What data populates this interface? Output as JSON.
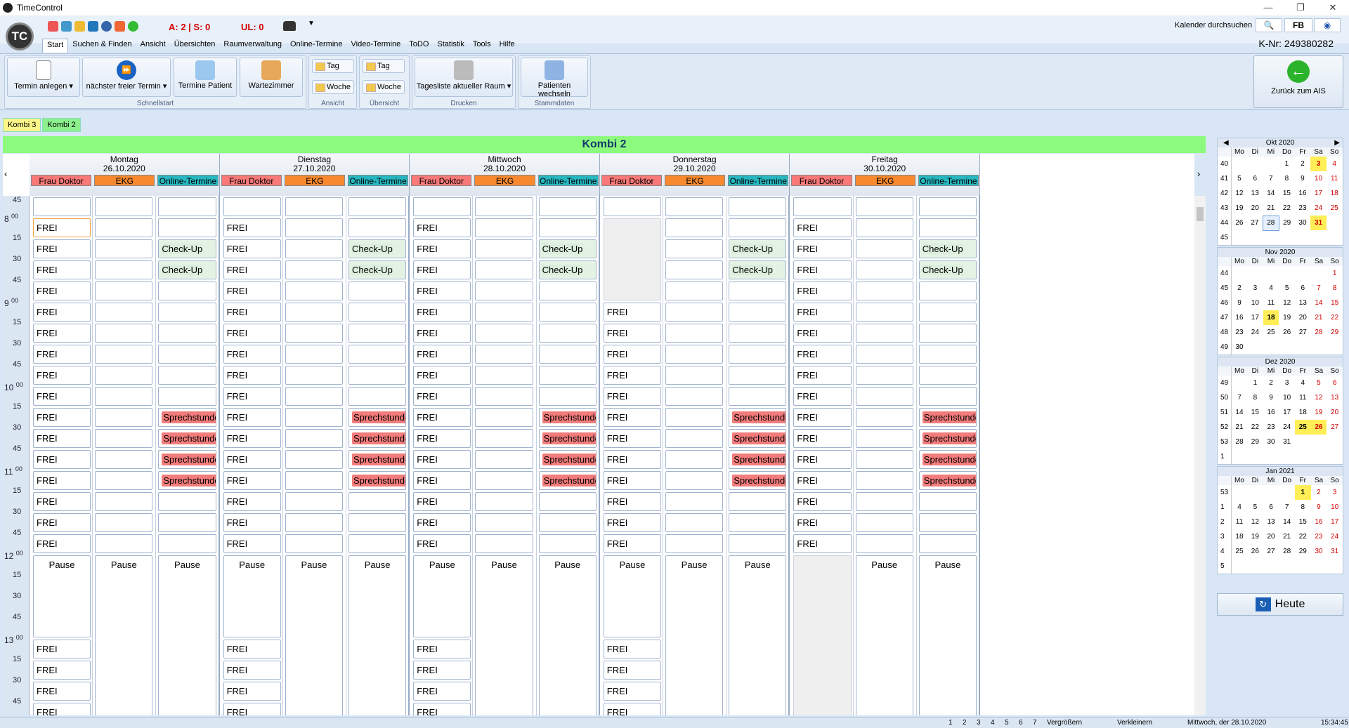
{
  "window": {
    "title": "TimeControl"
  },
  "toolbar": {
    "stat1": "A: 2 | S: 0",
    "stat2": "UL: 0",
    "search_label": "Kalender durchsuchen",
    "fb_label": "FB"
  },
  "menu": [
    "Start",
    "Suchen & Finden",
    "Ansicht",
    "Übersichten",
    "Raumverwaltung",
    "Online-Termine",
    "Video-Termine",
    "ToDO",
    "Statistik",
    "Tools",
    "Hilfe"
  ],
  "knr": "K-Nr: 249380282",
  "ribbon": {
    "termin_anlegen": "Termin anlegen",
    "naechster": "nächster freier Termin",
    "patient": "Termine Patient",
    "wartezimmer": "Wartezimmer",
    "schnellstart": "Schnellstart",
    "tag1": "Tag",
    "woche1": "Woche",
    "ansicht": "Ansicht",
    "tag2": "Tag",
    "woche2": "Woche",
    "uebersicht": "Übersicht",
    "tagesliste": "Tagesliste aktueller Raum",
    "drucken": "Drucken",
    "patienten_wechseln": "Patienten wechseln",
    "stammdaten": "Stammdaten",
    "zurueck": "Zurück zum AIS"
  },
  "tabs": [
    "Kombi 3",
    "Kombi 2"
  ],
  "banner": "Kombi 2",
  "resources": [
    "Frau Doktor",
    "EKG",
    "Online-Termine"
  ],
  "days": [
    {
      "name": "Montag",
      "date": "26.10.2020"
    },
    {
      "name": "Dienstag",
      "date": "27.10.2020"
    },
    {
      "name": "Mittwoch",
      "date": "28.10.2020"
    },
    {
      "name": "Donnerstag",
      "date": "29.10.2020"
    },
    {
      "name": "Freitag",
      "date": "30.10.2020"
    }
  ],
  "times": [
    {
      "h": "",
      "m": "45"
    },
    {
      "h": "8",
      "m": "00"
    },
    {
      "h": "",
      "m": "15"
    },
    {
      "h": "",
      "m": "30"
    },
    {
      "h": "",
      "m": "45"
    },
    {
      "h": "9",
      "m": "00"
    },
    {
      "h": "",
      "m": "15"
    },
    {
      "h": "",
      "m": "30"
    },
    {
      "h": "",
      "m": "45"
    },
    {
      "h": "10",
      "m": "00"
    },
    {
      "h": "",
      "m": "15"
    },
    {
      "h": "",
      "m": "30"
    },
    {
      "h": "",
      "m": "45"
    },
    {
      "h": "11",
      "m": "00"
    },
    {
      "h": "",
      "m": "15"
    },
    {
      "h": "",
      "m": "30"
    },
    {
      "h": "",
      "m": "45"
    },
    {
      "h": "12",
      "m": "00"
    },
    {
      "h": "",
      "m": "15"
    },
    {
      "h": "",
      "m": "30"
    },
    {
      "h": "",
      "m": "45"
    },
    {
      "h": "13",
      "m": "00"
    },
    {
      "h": "",
      "m": "15"
    },
    {
      "h": "",
      "m": "30"
    },
    {
      "h": "",
      "m": "45"
    }
  ],
  "labels": {
    "frei": "FREI",
    "checkup": "Check-Up",
    "sprech": "Sprechstunde",
    "pause": "Pause"
  },
  "minical": [
    {
      "title": "Okt 2020",
      "weeks": [
        [
          "40",
          "",
          "",
          "",
          "1",
          "2",
          "3",
          "4"
        ],
        [
          "41",
          "5",
          "6",
          "7",
          "8",
          "9",
          "10",
          "11"
        ],
        [
          "42",
          "12",
          "13",
          "14",
          "15",
          "16",
          "17",
          "18"
        ],
        [
          "43",
          "19",
          "20",
          "21",
          "22",
          "23",
          "24",
          "25"
        ],
        [
          "44",
          "26",
          "27",
          "28",
          "29",
          "30",
          "31",
          ""
        ],
        [
          "45",
          "",
          "",
          "",
          "",
          "",
          "",
          ""
        ]
      ]
    },
    {
      "title": "Nov 2020",
      "weeks": [
        [
          "44",
          "",
          "",
          "",
          "",
          "",
          "",
          "1"
        ],
        [
          "45",
          "2",
          "3",
          "4",
          "5",
          "6",
          "7",
          "8"
        ],
        [
          "46",
          "9",
          "10",
          "11",
          "12",
          "13",
          "14",
          "15"
        ],
        [
          "47",
          "16",
          "17",
          "18",
          "19",
          "20",
          "21",
          "22"
        ],
        [
          "48",
          "23",
          "24",
          "25",
          "26",
          "27",
          "28",
          "29"
        ],
        [
          "49",
          "30",
          "",
          "",
          "",
          "",
          "",
          ""
        ]
      ]
    },
    {
      "title": "Dez 2020",
      "weeks": [
        [
          "49",
          "",
          "1",
          "2",
          "3",
          "4",
          "5",
          "6"
        ],
        [
          "50",
          "7",
          "8",
          "9",
          "10",
          "11",
          "12",
          "13"
        ],
        [
          "51",
          "14",
          "15",
          "16",
          "17",
          "18",
          "19",
          "20"
        ],
        [
          "52",
          "21",
          "22",
          "23",
          "24",
          "25",
          "26",
          "27"
        ],
        [
          "53",
          "28",
          "29",
          "30",
          "31",
          "",
          "",
          ""
        ],
        [
          "1",
          "",
          "",
          "",
          "",
          "",
          "",
          ""
        ]
      ]
    },
    {
      "title": "Jan 2021",
      "weeks": [
        [
          "53",
          "",
          "",
          "",
          "",
          "1",
          "2",
          "3"
        ],
        [
          "1",
          "4",
          "5",
          "6",
          "7",
          "8",
          "9",
          "10"
        ],
        [
          "2",
          "11",
          "12",
          "13",
          "14",
          "15",
          "16",
          "17"
        ],
        [
          "3",
          "18",
          "19",
          "20",
          "21",
          "22",
          "23",
          "24"
        ],
        [
          "4",
          "25",
          "26",
          "27",
          "28",
          "29",
          "30",
          "31"
        ],
        [
          "5",
          "",
          "",
          "",
          "",
          "",
          "",
          ""
        ]
      ]
    }
  ],
  "weekday_short": [
    "Mo",
    "Di",
    "Mi",
    "Do",
    "Fr",
    "Sa",
    "So"
  ],
  "heute": "Heute",
  "status": {
    "pages": [
      "1",
      "2",
      "3",
      "4",
      "5",
      "6",
      "7"
    ],
    "vergroessern": "Vergrößern",
    "verkleinern": "Verkleinern",
    "date": "Mittwoch, der  28.10.2020",
    "time": "15:34:45"
  }
}
